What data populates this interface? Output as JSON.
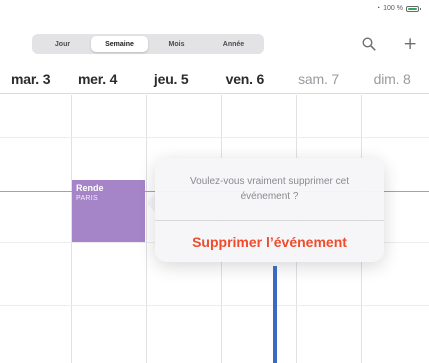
{
  "status_bar": {
    "wifi_icon": "wifi-icon",
    "battery_text": "100 %",
    "battery_icon": "battery-icon"
  },
  "segmented_control": {
    "segments": [
      "Jour",
      "Semaine",
      "Mois",
      "Année"
    ],
    "selected": "Semaine"
  },
  "toolbar": {
    "search_icon": "search-icon",
    "add_icon": "plus-icon",
    "add_glyph": "+"
  },
  "days": [
    {
      "label": "mar. 3",
      "weekend": false
    },
    {
      "label": "mer. 4",
      "weekend": false
    },
    {
      "label": "jeu. 5",
      "weekend": false
    },
    {
      "label": "ven. 6",
      "weekend": false
    },
    {
      "label": "sam. 7",
      "weekend": true
    },
    {
      "label": "dim. 8",
      "weekend": true
    }
  ],
  "event": {
    "title": "Rende",
    "location": "PARIS",
    "color": "#a584c8"
  },
  "popover": {
    "message": "Voulez-vous vraiment supprimer cet événement ?",
    "delete_label": "Supprimer l’événement",
    "delete_color": "#ef4c2c"
  },
  "colors": {
    "current_time_line": "#f08a5d",
    "annotation_pointer": "#3a6bbf"
  }
}
